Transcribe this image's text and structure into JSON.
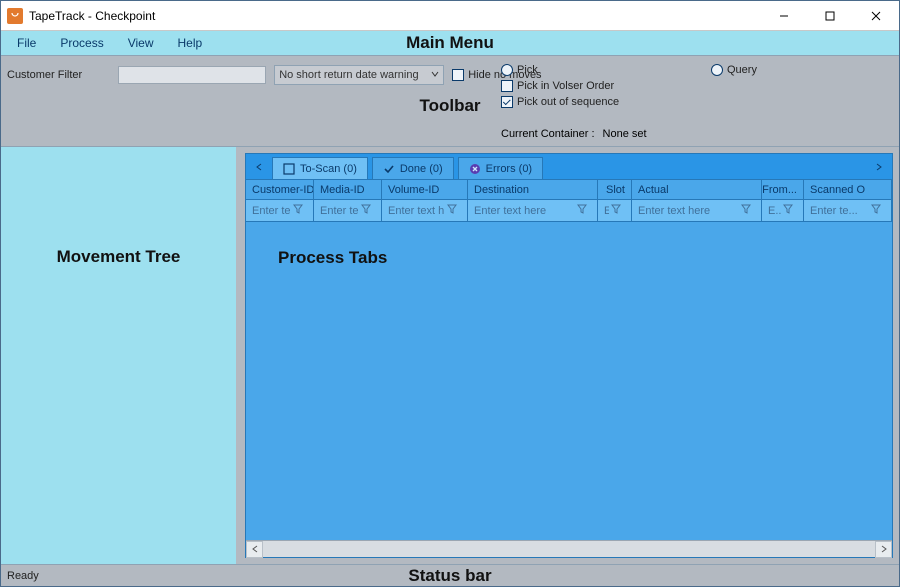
{
  "window": {
    "title": "TapeTrack - Checkpoint"
  },
  "menu": {
    "items": [
      "File",
      "Process",
      "View",
      "Help"
    ],
    "overlay": "Main Menu"
  },
  "toolbar": {
    "customer_filter_label": "Customer Filter",
    "dropdown_value": "No short return date warning",
    "hide_no_moves": "Hide no moves",
    "pick": "Pick",
    "pick_volser": "Pick in Volser Order",
    "pick_out_of_seq": "Pick out of sequence",
    "query": "Query",
    "current_container_label": "Current Container :",
    "current_container_value": "None set",
    "overlay": "Toolbar"
  },
  "left": {
    "overlay": "Movement Tree"
  },
  "tabs": {
    "to_scan": "To-Scan (0)",
    "done": "Done (0)",
    "errors": "Errors (0)"
  },
  "columns": [
    {
      "header": "Customer-ID",
      "placeholder": "Enter te..."
    },
    {
      "header": "Media-ID",
      "placeholder": "Enter te..."
    },
    {
      "header": "Volume-ID",
      "placeholder": "Enter text h..."
    },
    {
      "header": "Destination",
      "placeholder": "Enter text here"
    },
    {
      "header": "Slot",
      "placeholder": "E..."
    },
    {
      "header": "Actual",
      "placeholder": "Enter text here"
    },
    {
      "header": "From...",
      "placeholder": "E..."
    },
    {
      "header": "Scanned O",
      "placeholder": "Enter te..."
    }
  ],
  "grid_overlay": "Process Tabs",
  "status": {
    "ready": "Ready",
    "overlay": "Status bar"
  }
}
